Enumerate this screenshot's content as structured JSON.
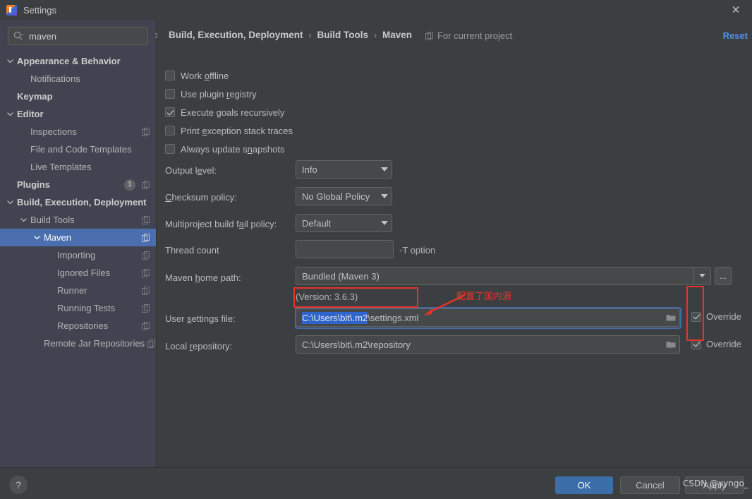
{
  "window": {
    "title": "Settings",
    "app_icon": "intellij-idea-icon",
    "close_icon": "close-icon"
  },
  "search": {
    "value": "maven",
    "placeholder": "Search settings",
    "icon": "search-icon",
    "clear_icon": "close-icon"
  },
  "sidebar": {
    "items": [
      {
        "label": "Appearance & Behavior",
        "indent": 0,
        "bold": true,
        "arrow": "chevron-down",
        "selected": false,
        "copy": false,
        "badge": null,
        "name": "sidebar-item-appearance-behavior"
      },
      {
        "label": "Notifications",
        "indent": 1,
        "bold": false,
        "arrow": "none",
        "selected": false,
        "copy": false,
        "badge": null,
        "name": "sidebar-item-notifications"
      },
      {
        "label": "Keymap",
        "indent": 0,
        "bold": true,
        "arrow": "none",
        "selected": false,
        "copy": false,
        "badge": null,
        "name": "sidebar-item-keymap"
      },
      {
        "label": "Editor",
        "indent": 0,
        "bold": true,
        "arrow": "chevron-down",
        "selected": false,
        "copy": false,
        "badge": null,
        "name": "sidebar-item-editor"
      },
      {
        "label": "Inspections",
        "indent": 1,
        "bold": false,
        "arrow": "none",
        "selected": false,
        "copy": true,
        "badge": null,
        "name": "sidebar-item-inspections"
      },
      {
        "label": "File and Code Templates",
        "indent": 1,
        "bold": false,
        "arrow": "none",
        "selected": false,
        "copy": false,
        "badge": null,
        "name": "sidebar-item-file-and-code-templates"
      },
      {
        "label": "Live Templates",
        "indent": 1,
        "bold": false,
        "arrow": "none",
        "selected": false,
        "copy": false,
        "badge": null,
        "name": "sidebar-item-live-templates"
      },
      {
        "label": "Plugins",
        "indent": 0,
        "bold": true,
        "arrow": "none",
        "selected": false,
        "copy": true,
        "badge": "1",
        "name": "sidebar-item-plugins"
      },
      {
        "label": "Build, Execution, Deployment",
        "indent": 0,
        "bold": true,
        "arrow": "chevron-down",
        "selected": false,
        "copy": false,
        "badge": null,
        "name": "sidebar-item-build-execution-deployment"
      },
      {
        "label": "Build Tools",
        "indent": 1,
        "bold": false,
        "arrow": "chevron-down",
        "selected": false,
        "copy": true,
        "badge": null,
        "name": "sidebar-item-build-tools"
      },
      {
        "label": "Maven",
        "indent": 2,
        "bold": false,
        "arrow": "chevron-down",
        "selected": true,
        "copy": true,
        "badge": null,
        "name": "sidebar-item-maven"
      },
      {
        "label": "Importing",
        "indent": 3,
        "bold": false,
        "arrow": "none",
        "selected": false,
        "copy": true,
        "badge": null,
        "name": "sidebar-item-importing"
      },
      {
        "label": "Ignored Files",
        "indent": 3,
        "bold": false,
        "arrow": "none",
        "selected": false,
        "copy": true,
        "badge": null,
        "name": "sidebar-item-ignored-files"
      },
      {
        "label": "Runner",
        "indent": 3,
        "bold": false,
        "arrow": "none",
        "selected": false,
        "copy": true,
        "badge": null,
        "name": "sidebar-item-runner"
      },
      {
        "label": "Running Tests",
        "indent": 3,
        "bold": false,
        "arrow": "none",
        "selected": false,
        "copy": true,
        "badge": null,
        "name": "sidebar-item-running-tests"
      },
      {
        "label": "Repositories",
        "indent": 3,
        "bold": false,
        "arrow": "none",
        "selected": false,
        "copy": true,
        "badge": null,
        "name": "sidebar-item-repositories"
      },
      {
        "label": "Remote Jar Repositories",
        "indent": 2,
        "bold": false,
        "arrow": "none",
        "selected": false,
        "copy": true,
        "badge": null,
        "name": "sidebar-item-remote-jar-repositories"
      }
    ]
  },
  "header": {
    "breadcrumb": [
      "Build, Execution, Deployment",
      "Build Tools",
      "Maven"
    ],
    "separator": "›",
    "for_current_project": "For current project",
    "for_current_project_icon": "copy-icon",
    "reset_label": "Reset",
    "reset_color": "#4d91e8"
  },
  "main": {
    "checkboxes": [
      {
        "label": "Work offline",
        "mnemonic": "o",
        "checked": false,
        "name": "checkbox-work-offline"
      },
      {
        "label": "Use plugin registry",
        "mnemonic": "r",
        "checked": false,
        "name": "checkbox-use-plugin-registry"
      },
      {
        "label": "Execute goals recursively",
        "mnemonic": "g",
        "checked": true,
        "name": "checkbox-execute-goals-recursively"
      },
      {
        "label": "Print exception stack traces",
        "mnemonic": "e",
        "checked": false,
        "name": "checkbox-print-exception-stack-traces"
      },
      {
        "label": "Always update snapshots",
        "mnemonic": "n",
        "checked": false,
        "name": "checkbox-always-update-snapshots"
      }
    ],
    "output_level": {
      "label": "Output level:",
      "value": "Info"
    },
    "checksum_policy": {
      "label": "Checksum policy:",
      "value": "No Global Policy"
    },
    "multiproject_policy": {
      "label": "Multiproject build fail policy:",
      "value": "Default"
    },
    "thread_count": {
      "label": "Thread count",
      "value": "",
      "hint": "-T option"
    },
    "maven_home": {
      "label": "Maven home path:",
      "value": "Bundled (Maven 3)",
      "version_note": "(Version: 3.6.3)",
      "browse_label": "..."
    },
    "user_settings": {
      "label": "User settings file:",
      "value_selected": "C:\\Users\\bit\\.m2",
      "value_rest": "\\settings.xml",
      "override_label": "Override",
      "override_checked": true,
      "folder_icon": "folder-icon"
    },
    "local_repository": {
      "label": "Local repository:",
      "value": "C:\\Users\\bit\\.m2\\repository",
      "override_label": "Override",
      "override_checked": true,
      "folder_icon": "folder-icon"
    }
  },
  "annotations": {
    "note_text": "配置了国内源",
    "note_color": "#e8332a"
  },
  "footer": {
    "help_label": "?",
    "ok_label": "OK",
    "cancel_label": "Cancel",
    "apply_label": "Apply",
    "watermark": "CSDN @yyngo_",
    "ok_color": "#3b6ea8"
  }
}
